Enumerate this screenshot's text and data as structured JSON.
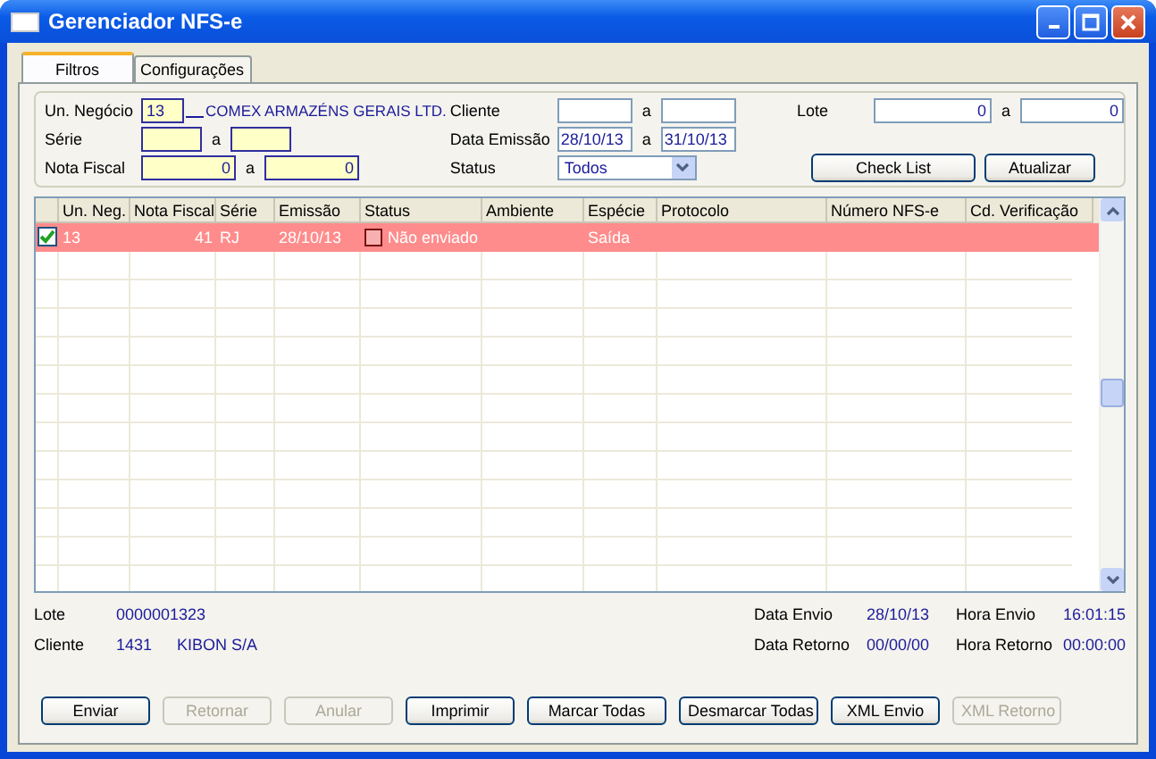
{
  "window": {
    "title": "Gerenciador NFS-e"
  },
  "tabs": [
    {
      "label": "Filtros",
      "selected": true
    },
    {
      "label": "Configurações",
      "selected": false
    }
  ],
  "filters": {
    "un_negocio": {
      "label": "Un. Negócio",
      "value": "13",
      "description": "COMEX ARMAZÉNS GERAIS LTD."
    },
    "serie": {
      "label": "Série",
      "separator": "a"
    },
    "nota_fiscal": {
      "label": "Nota Fiscal",
      "from": "0",
      "separator": "a",
      "to": "0"
    },
    "cliente": {
      "label": "Cliente",
      "separator": "a"
    },
    "data_emissao": {
      "label": "Data Emissão",
      "from": "28/10/13",
      "separator": "a",
      "to": "31/10/13"
    },
    "status": {
      "label": "Status",
      "value": "Todos"
    },
    "lote": {
      "label": "Lote",
      "from": "0",
      "separator": "a",
      "to": "0"
    },
    "buttons": [
      "Check List",
      "Atualizar"
    ]
  },
  "grid": {
    "columns": [
      "Un. Neg.",
      "Nota Fiscal",
      "Série",
      "Emissão",
      "Status",
      "Ambiente",
      "Espécie",
      "Protocolo",
      "Número NFS-e",
      "Cd. Verificação"
    ],
    "rows": [
      {
        "checked": true,
        "selected": true,
        "cells": [
          "13",
          "41",
          "RJ",
          "28/10/13",
          "Não enviado",
          null,
          "Saída",
          null,
          null,
          null
        ]
      }
    ]
  },
  "details": {
    "lote": {
      "label": "Lote",
      "value": "0000001323"
    },
    "cliente": {
      "label": "Cliente",
      "code": "1431",
      "name": "KIBON S/A"
    },
    "data_envio": {
      "label": "Data Envio",
      "value": "28/10/13"
    },
    "hora_envio": {
      "label": "Hora Envio",
      "value": "16:01:15"
    },
    "data_retorno": {
      "label": "Data Retorno",
      "value": "00/00/00"
    },
    "hora_retorno": {
      "label": "Hora Retorno",
      "value": "00:00:00"
    }
  },
  "actions": [
    {
      "label": "Enviar",
      "disabled": false
    },
    {
      "label": "Retornar",
      "disabled": true
    },
    {
      "label": "Anular",
      "disabled": true
    },
    {
      "label": "Imprimir",
      "disabled": false
    },
    {
      "label": "Marcar Todas",
      "disabled": false
    },
    {
      "label": "Desmarcar Todas",
      "disabled": false
    },
    {
      "label": "XML Envio",
      "disabled": false
    },
    {
      "label": "XML Retorno",
      "disabled": true
    }
  ]
}
